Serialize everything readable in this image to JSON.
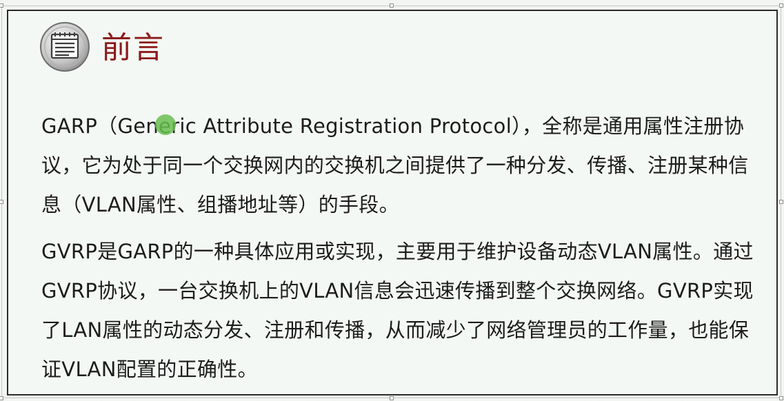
{
  "slide": {
    "title": "前言",
    "title_icon": "notepad-icon",
    "paragraphs": [
      "GARP（Generic Attribute Registration Protocol），全称是通用属性注册协议，它为处于同一个交换网内的交换机之间提供了一种分发、传播、注册某种信息（VLAN属性、组播地址等）的手段。",
      "GVRP是GARP的一种具体应用或实现，主要用于维护设备动态VLAN属性。通过GVRP协议，一台交换机上的VLAN信息会迅速传播到整个交换网络。GVRP实现了LAN属性的动态分发、注册和传播，从而减少了网络管理员的工作量，也能保证VLAN配置的正确性。"
    ]
  },
  "colors": {
    "title": "#8b1a1a",
    "body_text": "#1c1c1c",
    "background": "#f4f8f4",
    "cursor_highlight": "#69be50"
  }
}
